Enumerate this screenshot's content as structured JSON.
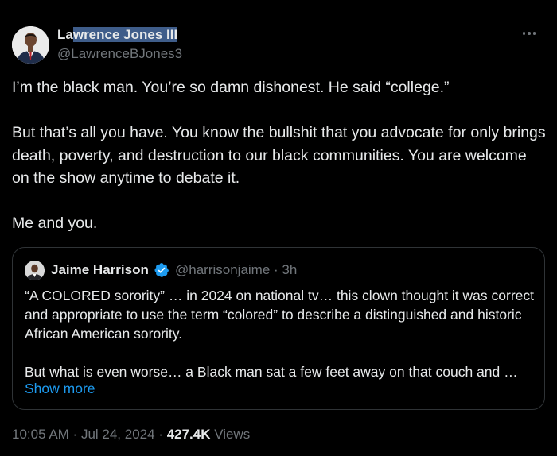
{
  "post": {
    "author": {
      "name_plain": "La",
      "name_selected": "wrence Jones III",
      "handle": "@LawrenceBJones3"
    },
    "text": "I’m the black man. You’re so damn dishonest. He said “college.”\n\nBut that’s all you have. You know the bullshit that you advocate for only brings death, poverty, and destruction to our black communities. You are welcome on the show anytime to debate it.\n\nMe and you.",
    "more_icon": "more-horizontal-icon"
  },
  "quote": {
    "author_name": "Jaime Harrison",
    "verified_icon": "verified-badge-icon",
    "handle_time": "@harrisonjaime · 3h",
    "text": "“A COLORED sorority” … in 2024 on national tv… this clown thought it was correct and appropriate to use the term “colored” to describe a distinguished and historic African American sorority.\n\nBut what is even worse… a Black man sat a few feet away on that couch and …",
    "show_more": "Show more"
  },
  "meta": {
    "time": "10:05 AM",
    "sep1": " · ",
    "date": "Jul 24, 2024",
    "sep2": " · ",
    "views_count": "427.4K",
    "views_label": " Views"
  },
  "colors": {
    "background": "#000000",
    "text": "#e7e9ea",
    "muted": "#71767b",
    "link": "#1d9bf0",
    "border": "#2f3336",
    "selection": "#3f5d8a"
  }
}
